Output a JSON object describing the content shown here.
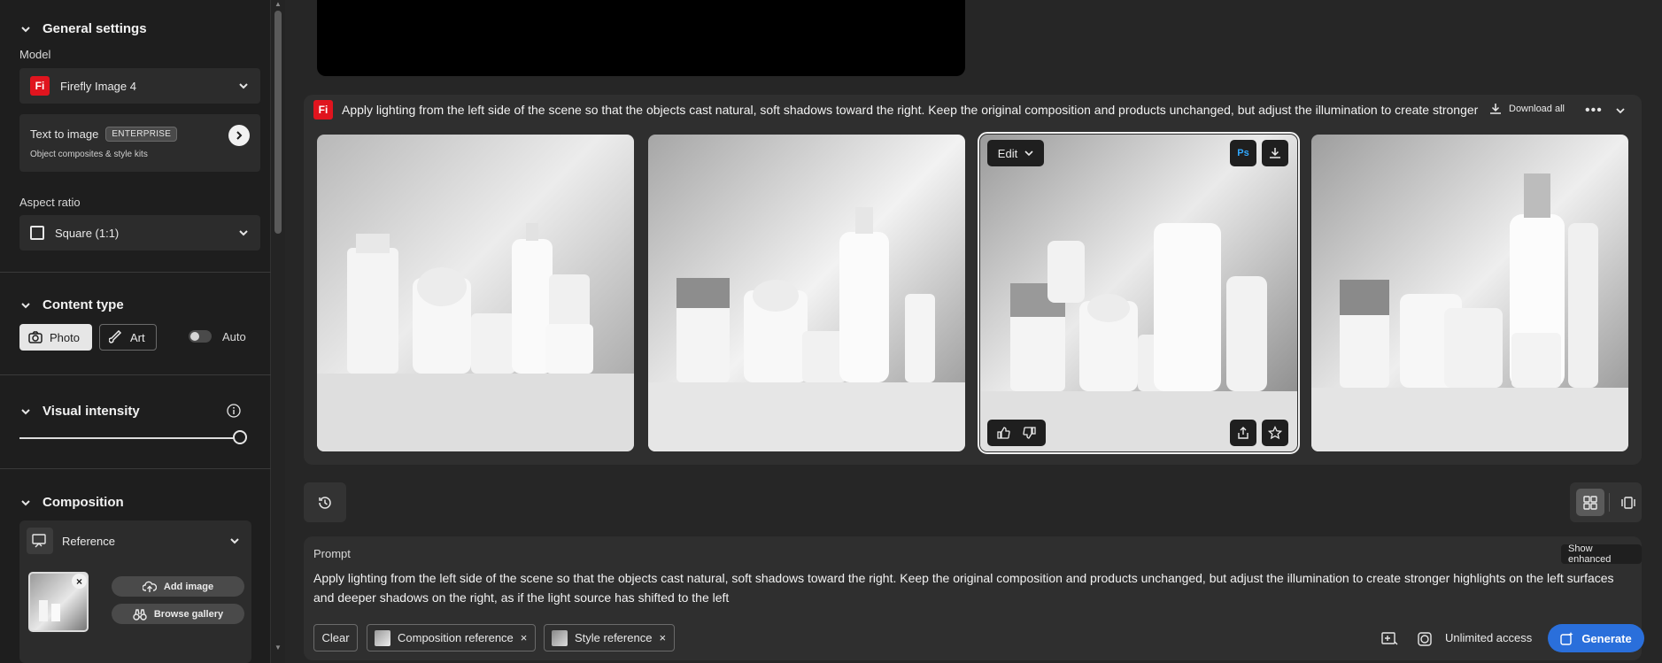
{
  "sidebar": {
    "general_settings": "General settings",
    "model_label": "Model",
    "model_value": "Firefly Image 4",
    "model_badge": "Fi",
    "t2i_title": "Text to image",
    "t2i_badge": "ENTERPRISE",
    "t2i_sub": "Object composites & style kits",
    "aspect_label": "Aspect ratio",
    "aspect_value": "Square (1:1)",
    "content_type": "Content type",
    "photo": "Photo",
    "art": "Art",
    "auto": "Auto",
    "auto_enabled": false,
    "visual_intensity": "Visual intensity",
    "visual_intensity_level": 1.0,
    "composition": "Composition",
    "reference": "Reference",
    "add_image": "Add image",
    "browse_gallery": "Browse gallery"
  },
  "results": {
    "badge": "Fi",
    "prompt_text": "Apply lighting from the left side of the scene so that the objects cast natural, soft shadows toward the right. Keep the original composition and products unchanged, but adjust the illumination to create stronger highlights on the left surfaces and deeper shadows on the right, as if the light source has shifted to the left",
    "download_all": "Download all",
    "edit": "Edit",
    "ps": "Ps"
  },
  "prompt": {
    "label": "Prompt",
    "show_enhanced": "Show enhanced",
    "text": "Apply lighting from the left side of the scene so that the objects cast natural, soft shadows toward the right. Keep the original composition and products unchanged, but adjust the illumination to create stronger highlights on the left surfaces and deeper shadows on the right, as if the light source has shifted to the left",
    "clear": "Clear",
    "chip_composition": "Composition reference",
    "chip_style": "Style reference",
    "unlimited": "Unlimited access",
    "generate": "Generate"
  },
  "colors": {
    "accent": "#2a6fdb",
    "firefly_red": "#e0141e",
    "ps_blue": "#31a8ff"
  }
}
